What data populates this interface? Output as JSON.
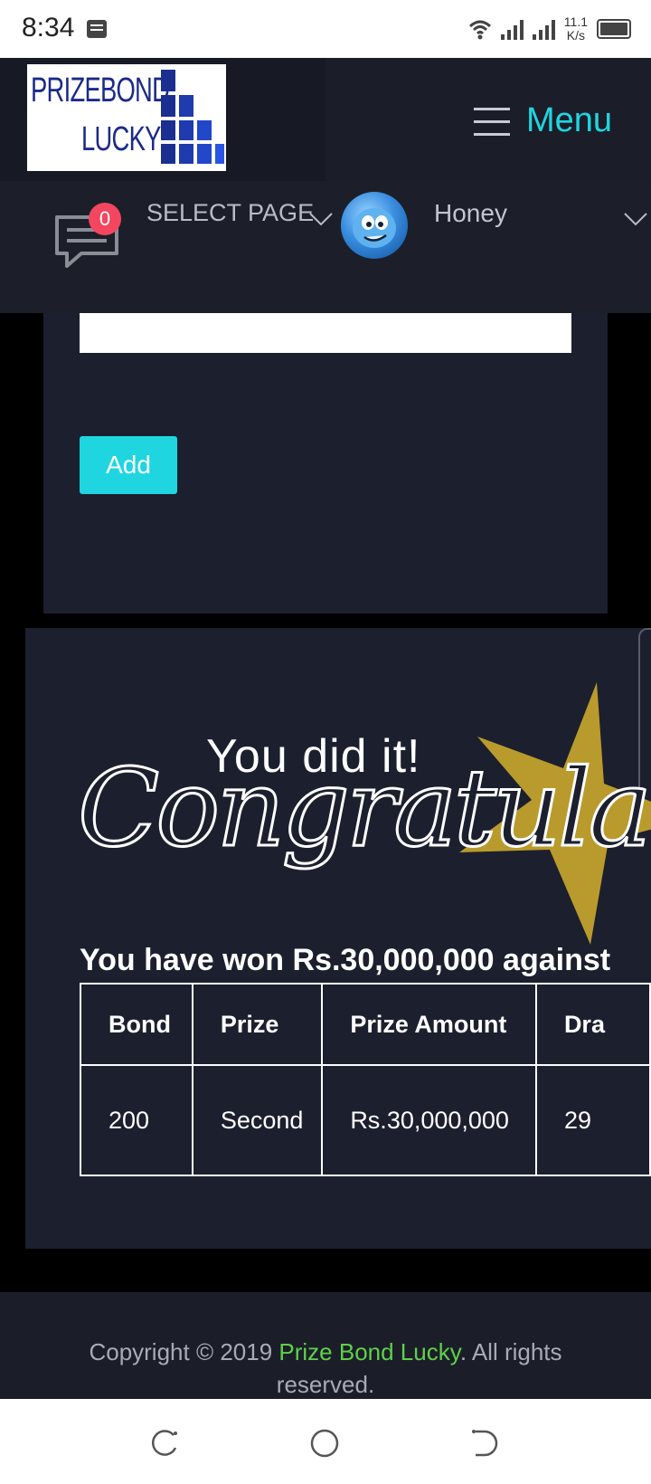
{
  "status_bar": {
    "time": "8:34",
    "net_speed_value": "11.1",
    "net_speed_unit": "K/s",
    "icons": [
      "message-notification-icon",
      "wifi-icon",
      "signal-icon",
      "signal-icon",
      "battery-icon"
    ]
  },
  "header": {
    "logo_line1": "PRIZEBOND",
    "logo_line2": "LUCKY",
    "menu_label": "Menu",
    "chat_badge": "0",
    "select_page": "SELECT PAGE",
    "user_name": "Honey"
  },
  "form": {
    "input_value": "",
    "add_label": "Add"
  },
  "result": {
    "headline_small": "You did it!",
    "headline_script": "Congratulati",
    "win_text": "You have won Rs.30,000,000 against",
    "table": {
      "headers": [
        "Bond",
        "Prize",
        "Prize Amount",
        "Dra"
      ],
      "rows": [
        [
          "200",
          "Second",
          "Rs.30,000,000",
          "29"
        ]
      ]
    }
  },
  "footer": {
    "prefix": "Copyright © 2019 ",
    "link": "Prize Bond Lucky",
    "suffix": ". All rights reserved."
  },
  "colors": {
    "accent": "#1fd6e0",
    "badge": "#f4465f",
    "footer_link": "#5fd14a",
    "star": "#b99a2c"
  }
}
